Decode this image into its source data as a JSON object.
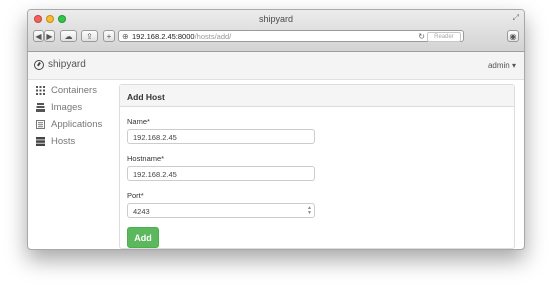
{
  "window": {
    "title": "shipyard"
  },
  "browser": {
    "url_host": "192.168.2.45:8000",
    "url_path": "/hosts/add/",
    "reader_label": "Reader"
  },
  "app": {
    "brand": "shipyard",
    "user_menu": "admin ▾"
  },
  "sidebar": {
    "items": [
      {
        "label": "Containers",
        "icon": "grid-icon"
      },
      {
        "label": "Images",
        "icon": "stack-icon"
      },
      {
        "label": "Applications",
        "icon": "list-icon"
      },
      {
        "label": "Hosts",
        "icon": "server-icon"
      }
    ]
  },
  "form": {
    "title": "Add Host",
    "name_label": "Name*",
    "name_value": "192.168.2.45",
    "hostname_label": "Hostname*",
    "hostname_value": "192.168.2.45",
    "port_label": "Port*",
    "port_value": "4243",
    "submit_label": "Add"
  },
  "colors": {
    "accent_green": "#5cb85c"
  }
}
